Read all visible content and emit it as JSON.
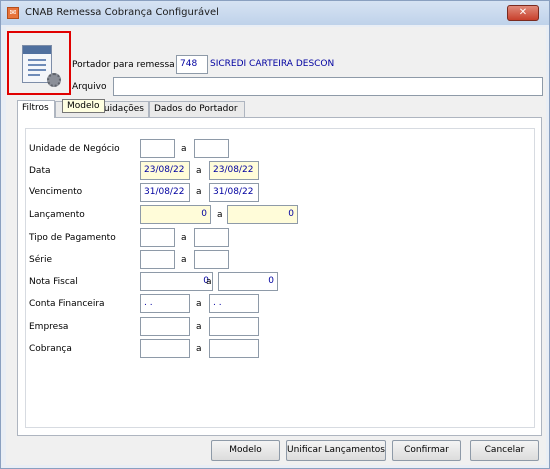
{
  "window": {
    "title": "CNAB Remessa Cobrança Configurável",
    "close_label": "✕"
  },
  "header": {
    "portador_label": "Portador para remessa",
    "portador_code": "748",
    "portador_name": "SICREDI CARTEIRA DESCON",
    "arquivo_label": "Arquivo",
    "arquivo_value": ""
  },
  "tooltip": "Modelo",
  "tabs": [
    "Filtros",
    "Liquidações",
    "Dados do Portador"
  ],
  "tab_partial": "quidações",
  "filters": {
    "separator": "a",
    "unidade": {
      "label": "Unidade de Negócio",
      "from": "",
      "to": ""
    },
    "data": {
      "label": "Data",
      "from": "23/08/22",
      "to": "23/08/22"
    },
    "vencimento": {
      "label": "Vencimento",
      "from": "31/08/22",
      "to": "31/08/22"
    },
    "lancamento": {
      "label": "Lançamento",
      "from": "0",
      "to": "0"
    },
    "tipo_pagamento": {
      "label": "Tipo de Pagamento",
      "from": "",
      "to": ""
    },
    "serie": {
      "label": "Série",
      "from": "",
      "to": ""
    },
    "nota_fiscal": {
      "label": "Nota Fiscal",
      "from": "0",
      "to": "0"
    },
    "conta_financeira": {
      "label": "Conta Financeira",
      "from": " .  .",
      "to": " .  ."
    },
    "empresa": {
      "label": "Empresa",
      "from": "",
      "to": ""
    },
    "cobranca": {
      "label": "Cobrança",
      "from": "",
      "to": ""
    }
  },
  "buttons": {
    "modelo": "Modelo",
    "unificar": "Unificar Lançamentos",
    "confirmar": "Confirmar",
    "cancelar": "Cancelar"
  },
  "colors": {
    "highlight_border": "#e00000",
    "date_field_bg": "#fffcd9",
    "value_text": "#0000a0"
  },
  "icons": [
    "report-config-icon",
    "app-icon",
    "close-icon",
    "gear-icon"
  ]
}
